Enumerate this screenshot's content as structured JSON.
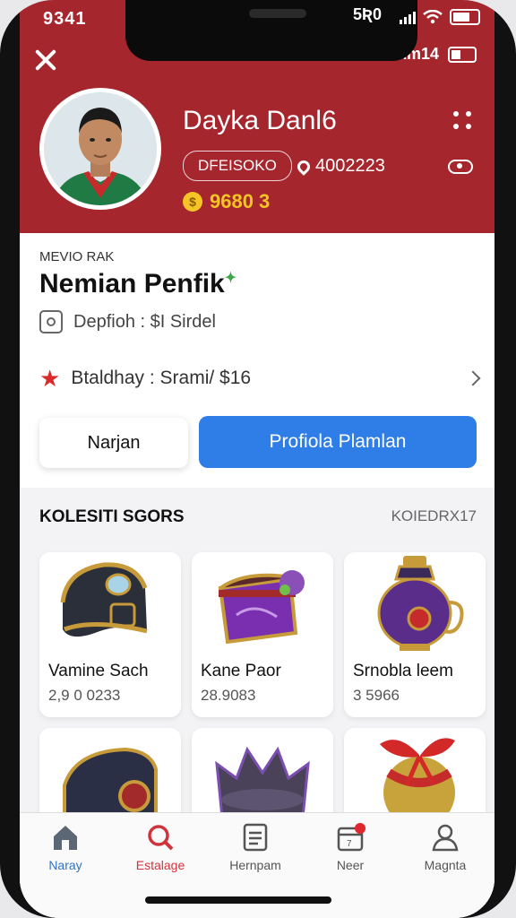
{
  "status": {
    "time": "9341",
    "notch_time": "5Ʀ0",
    "sub_label": "ilIAm14"
  },
  "profile": {
    "name": "Dayka Danl6",
    "id_pill": "DFEISOKO",
    "location": "4002223",
    "coins": "9680 3"
  },
  "rank": {
    "label": "MEVIO RAK",
    "title": "Nemian Penfik",
    "deposit": "Depfioh : $I Sirdel",
    "birthday": "Btaldhay : Srami/ $16"
  },
  "buttons": {
    "secondary": "Narjan",
    "primary": "Profiola Plamlan"
  },
  "collection": {
    "title": "KOLESITI SGORS",
    "count": "KOIEDRX17",
    "items": [
      {
        "name": "Vamine Sach",
        "price": "2,9 0 0233"
      },
      {
        "name": "Kane Paor",
        "price": "28.9083"
      },
      {
        "name": "Srnobla leem",
        "price": "3 5966"
      }
    ]
  },
  "tabs": [
    {
      "label": "Naray"
    },
    {
      "label": "Estalage"
    },
    {
      "label": "Hernpam"
    },
    {
      "label": "Neer"
    },
    {
      "label": "Magnta"
    }
  ],
  "colors": {
    "brand_red": "#a6262e",
    "primary_blue": "#2f7de6",
    "coin_gold": "#f5c526"
  }
}
